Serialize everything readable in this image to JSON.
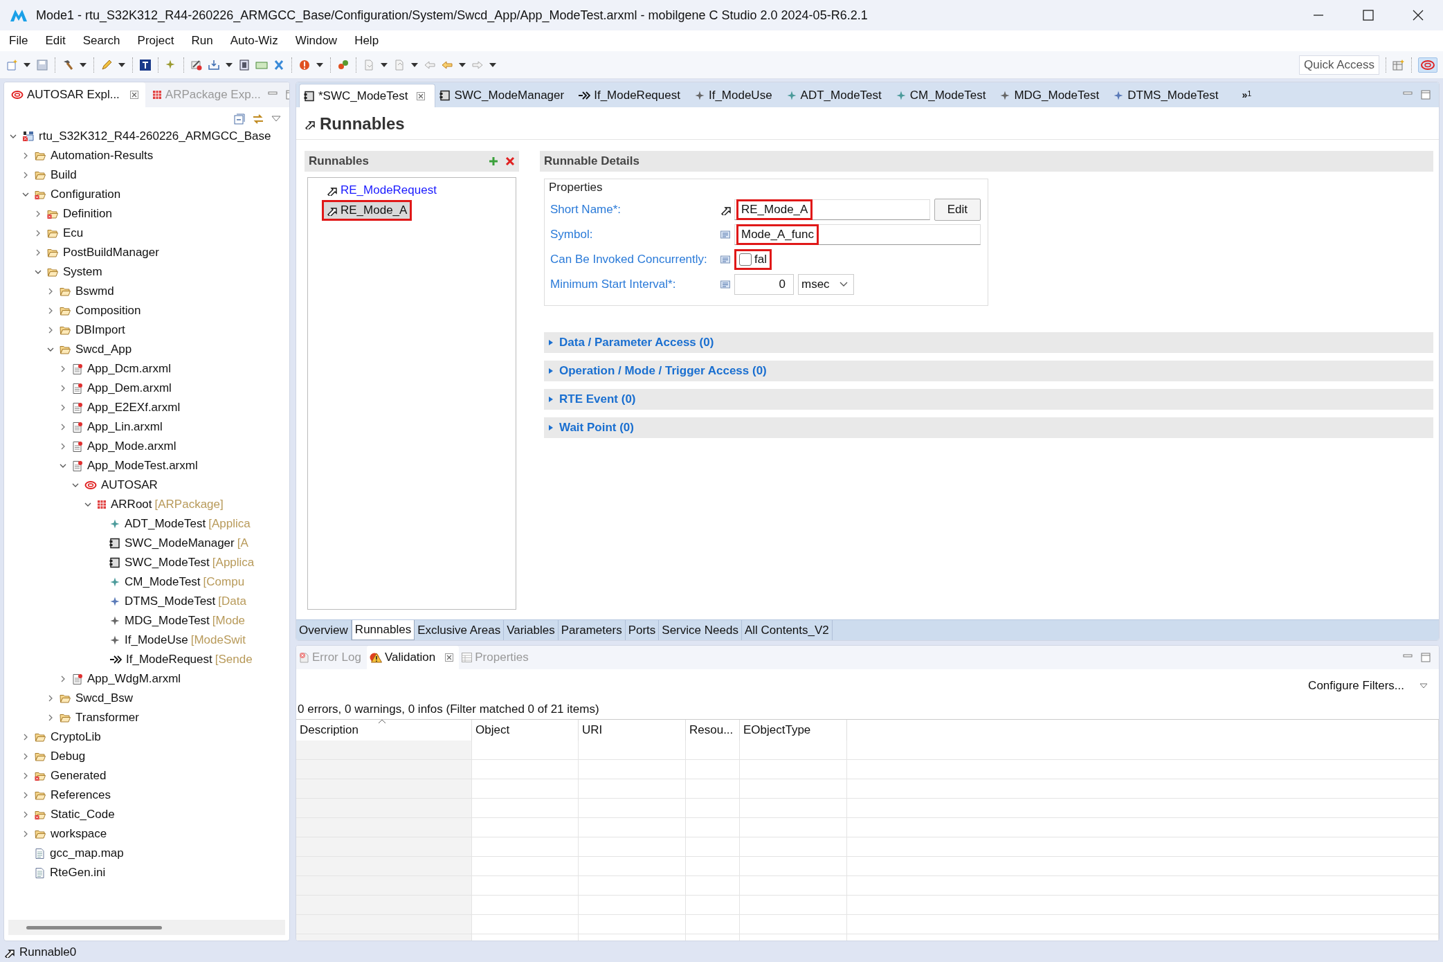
{
  "window": {
    "title": "Mode1 - rtu_S32K312_R44-260226_ARMGCC_Base/Configuration/System/Swcd_App/App_ModeTest.arxml - mobilgene C Studio 2.0 2024-05-R6.2.1"
  },
  "menu": [
    "File",
    "Edit",
    "Search",
    "Project",
    "Run",
    "Auto-Wiz",
    "Window",
    "Help"
  ],
  "quick_access": {
    "placeholder": "Quick Access"
  },
  "explorer": {
    "tabs": [
      {
        "label": "AUTOSAR Expl...",
        "kind": "autosar",
        "selected": true
      },
      {
        "label": "ARPackage Exp...",
        "kind": "package",
        "selected": false
      }
    ],
    "tree": [
      {
        "label": "rtu_S32K312_R44-260226_ARMGCC_Base",
        "kind": "project",
        "expanded": true,
        "children": [
          {
            "label": "Automation-Results",
            "kind": "folder",
            "expanded": false
          },
          {
            "label": "Build",
            "kind": "folder",
            "expanded": false
          },
          {
            "label": "Configuration",
            "kind": "folder-error",
            "expanded": true,
            "children": [
              {
                "label": "Definition",
                "kind": "folder-error",
                "expanded": false
              },
              {
                "label": "Ecu",
                "kind": "folder",
                "expanded": false
              },
              {
                "label": "PostBuildManager",
                "kind": "folder",
                "expanded": false
              },
              {
                "label": "System",
                "kind": "folder",
                "expanded": true,
                "children": [
                  {
                    "label": "Bswmd",
                    "kind": "folder",
                    "expanded": false
                  },
                  {
                    "label": "Composition",
                    "kind": "folder",
                    "expanded": false
                  },
                  {
                    "label": "DBImport",
                    "kind": "folder",
                    "expanded": false
                  },
                  {
                    "label": "Swcd_App",
                    "kind": "folder",
                    "expanded": true,
                    "children": [
                      {
                        "label": "App_Dcm.arxml",
                        "kind": "file-arxml",
                        "expanded": false
                      },
                      {
                        "label": "App_Dem.arxml",
                        "kind": "file-arxml",
                        "expanded": false
                      },
                      {
                        "label": "App_E2EXf.arxml",
                        "kind": "file-arxml",
                        "expanded": false
                      },
                      {
                        "label": "App_Lin.arxml",
                        "kind": "file-arxml",
                        "expanded": false
                      },
                      {
                        "label": "App_Mode.arxml",
                        "kind": "file-arxml",
                        "expanded": false
                      },
                      {
                        "label": "App_ModeTest.arxml",
                        "kind": "file-arxml",
                        "expanded": true,
                        "children": [
                          {
                            "label": "AUTOSAR",
                            "kind": "autosar",
                            "expanded": true,
                            "children": [
                              {
                                "label": "ARRoot",
                                "note": "[ARPackage]",
                                "kind": "package",
                                "expanded": true,
                                "children": [
                                  {
                                    "label": "ADT_ModeTest",
                                    "note": "[Applica",
                                    "kind": "element-teal"
                                  },
                                  {
                                    "label": "SWC_ModeManager",
                                    "note": "[A",
                                    "kind": "component"
                                  },
                                  {
                                    "label": "SWC_ModeTest",
                                    "note": "[Applica",
                                    "kind": "component"
                                  },
                                  {
                                    "label": "CM_ModeTest",
                                    "note": "[Compu",
                                    "kind": "element-teal"
                                  },
                                  {
                                    "label": "DTMS_ModeTest",
                                    "note": "[Data",
                                    "kind": "element-blue"
                                  },
                                  {
                                    "label": "MDG_ModeTest",
                                    "note": "[Mode",
                                    "kind": "element-gray"
                                  },
                                  {
                                    "label": "If_ModeUse",
                                    "note": "[ModeSwit",
                                    "kind": "element-gray"
                                  },
                                  {
                                    "label": "If_ModeRequest",
                                    "note": "[Sende",
                                    "kind": "interface"
                                  }
                                ]
                              }
                            ]
                          }
                        ]
                      },
                      {
                        "label": "App_WdgM.arxml",
                        "kind": "file-arxml",
                        "expanded": false
                      }
                    ]
                  },
                  {
                    "label": "Swcd_Bsw",
                    "kind": "folder",
                    "expanded": false
                  },
                  {
                    "label": "Transformer",
                    "kind": "folder",
                    "expanded": false
                  }
                ]
              }
            ]
          },
          {
            "label": "CryptoLib",
            "kind": "folder",
            "expanded": false
          },
          {
            "label": "Debug",
            "kind": "folder",
            "expanded": false
          },
          {
            "label": "Generated",
            "kind": "folder-error",
            "expanded": false
          },
          {
            "label": "References",
            "kind": "folder",
            "expanded": false
          },
          {
            "label": "Static_Code",
            "kind": "folder-error",
            "expanded": false
          },
          {
            "label": "workspace",
            "kind": "folder",
            "expanded": false
          },
          {
            "label": "gcc_map.map",
            "kind": "file-text"
          },
          {
            "label": "RteGen.ini",
            "kind": "file-text"
          }
        ]
      }
    ]
  },
  "editor": {
    "tabs": [
      {
        "label": "*SWC_ModeTest",
        "kind": "component",
        "selected": true
      },
      {
        "label": "SWC_ModeManager",
        "kind": "component",
        "selected": false
      },
      {
        "label": "If_ModeRequest",
        "kind": "interface",
        "selected": false
      },
      {
        "label": "If_ModeUse",
        "kind": "element-gray",
        "selected": false
      },
      {
        "label": "ADT_ModeTest",
        "kind": "element-teal",
        "selected": false
      },
      {
        "label": "CM_ModeTest",
        "kind": "element-teal",
        "selected": false
      },
      {
        "label": "MDG_ModeTest",
        "kind": "element-gray",
        "selected": false
      },
      {
        "label": "DTMS_ModeTest",
        "kind": "element-blue",
        "selected": false
      }
    ],
    "overflow": {
      "label": "»",
      "count": "1"
    },
    "page_title": "Runnables",
    "runnables": {
      "title": "Runnables",
      "items": [
        {
          "label": "RE_ModeRequest",
          "selected": false,
          "highlighted": false
        },
        {
          "label": "RE_Mode_A",
          "selected": true,
          "highlighted": true
        }
      ]
    },
    "details": {
      "title": "Runnable Details",
      "group": "Properties",
      "fields": [
        {
          "kind": "name",
          "label": "Short Name*:",
          "value": "RE_Mode_A",
          "highlighted": true,
          "button": "Edit"
        },
        {
          "kind": "text",
          "label": "Symbol:",
          "value": "Mode_A_func",
          "highlighted": true
        },
        {
          "kind": "checkbox",
          "label": "Can Be Invoked Concurrently:",
          "checked": false,
          "text": "fal",
          "highlighted": true
        },
        {
          "kind": "number",
          "label": "Minimum Start Interval*:",
          "value": "0",
          "unit": "msec",
          "highlighted": false
        }
      ]
    },
    "sections": [
      {
        "label": "Data / Parameter Access (0)",
        "expanded": false
      },
      {
        "label": "Operation / Mode / Trigger Access (0)",
        "expanded": false
      },
      {
        "label": "RTE Event (0)",
        "expanded": false
      },
      {
        "label": "Wait Point (0)",
        "expanded": false
      }
    ],
    "page_tabs": [
      {
        "label": "Overview",
        "selected": false
      },
      {
        "label": "Runnables",
        "selected": true
      },
      {
        "label": "Exclusive Areas",
        "selected": false
      },
      {
        "label": "Variables",
        "selected": false
      },
      {
        "label": "Parameters",
        "selected": false
      },
      {
        "label": "Ports",
        "selected": false
      },
      {
        "label": "Service Needs",
        "selected": false
      },
      {
        "label": "All Contents_V2",
        "selected": false
      }
    ]
  },
  "validation": {
    "tabs": [
      {
        "label": "Error Log",
        "kind": "error-log",
        "selected": false
      },
      {
        "label": "Validation",
        "kind": "validation",
        "selected": true
      },
      {
        "label": "Properties",
        "kind": "properties",
        "selected": false
      }
    ],
    "configure": "Configure Filters...",
    "summary": "0 errors, 0 warnings, 0 infos (Filter matched 0 of 21 items)",
    "columns": [
      "Description",
      "Object",
      "URI",
      "Resou...",
      "EObjectType"
    ]
  },
  "status_bar": {
    "text": "Runnable0"
  }
}
